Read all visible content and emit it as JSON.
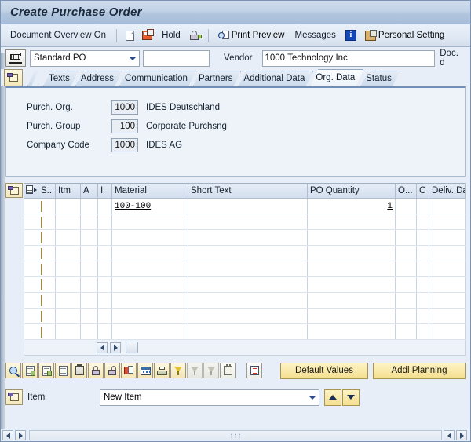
{
  "window": {
    "title": "Create Purchase Order"
  },
  "toolbar": {
    "document_overview": "Document Overview On",
    "hold": "Hold",
    "print_preview": "Print Preview",
    "messages": "Messages",
    "personal_setting": "Personal Setting",
    "icons": {
      "new_document": "new-document-icon",
      "copy": "copy-icon",
      "check_lock": "lock-icon",
      "print_preview": "print-preview-icon",
      "info": "info-icon",
      "personal_setting": "personal-setting-icon"
    }
  },
  "header": {
    "cart_icon": "shopping-cart-icon",
    "po_type": "Standard PO",
    "po_number": "",
    "vendor_label": "Vendor",
    "vendor_value": "1000 Technology Inc",
    "doc_date_label": "Doc. d"
  },
  "tabs": {
    "expand_icon": "header-detail-icon",
    "items": [
      {
        "label": "Texts",
        "active": false
      },
      {
        "label": "Address",
        "active": false
      },
      {
        "label": "Communication",
        "active": false
      },
      {
        "label": "Partners",
        "active": false
      },
      {
        "label": "Additional Data",
        "active": false
      },
      {
        "label": "Org. Data",
        "active": true
      },
      {
        "label": "Status",
        "active": false
      }
    ]
  },
  "org_data": {
    "fields": [
      {
        "label": "Purch. Org.",
        "value": "1000",
        "description": "IDES Deutschland"
      },
      {
        "label": "Purch. Group",
        "value": "100",
        "description": "Corporate Purchsng"
      },
      {
        "label": "Company Code",
        "value": "1000",
        "description": "IDES AG"
      }
    ]
  },
  "items_grid": {
    "left_icon": "item-detail-icon",
    "header_icon": "select-layout-icon",
    "columns": [
      {
        "key": "ctrl",
        "label": ""
      },
      {
        "key": "sel",
        "label": ""
      },
      {
        "key": "status",
        "label": "S.."
      },
      {
        "key": "itm",
        "label": "Itm"
      },
      {
        "key": "a",
        "label": "A"
      },
      {
        "key": "i",
        "label": "I"
      },
      {
        "key": "material",
        "label": "Material"
      },
      {
        "key": "short_text",
        "label": "Short Text"
      },
      {
        "key": "po_quantity",
        "label": "PO Quantity"
      },
      {
        "key": "o",
        "label": "O..."
      },
      {
        "key": "c",
        "label": "C"
      },
      {
        "key": "deliv_date",
        "label": "Deliv. Date"
      }
    ],
    "rows": [
      {
        "itm": "",
        "a": "",
        "i": "",
        "material": "100-100",
        "short_text": "",
        "po_quantity": "1",
        "o": "",
        "c": "",
        "deliv_date": ""
      },
      {
        "itm": "",
        "a": "",
        "i": "",
        "material": "",
        "short_text": "",
        "po_quantity": "",
        "o": "",
        "c": "",
        "deliv_date": ""
      },
      {
        "itm": "",
        "a": "",
        "i": "",
        "material": "",
        "short_text": "",
        "po_quantity": "",
        "o": "",
        "c": "",
        "deliv_date": ""
      },
      {
        "itm": "",
        "a": "",
        "i": "",
        "material": "",
        "short_text": "",
        "po_quantity": "",
        "o": "",
        "c": "",
        "deliv_date": ""
      },
      {
        "itm": "",
        "a": "",
        "i": "",
        "material": "",
        "short_text": "",
        "po_quantity": "",
        "o": "",
        "c": "",
        "deliv_date": ""
      },
      {
        "itm": "",
        "a": "",
        "i": "",
        "material": "",
        "short_text": "",
        "po_quantity": "",
        "o": "",
        "c": "",
        "deliv_date": ""
      },
      {
        "itm": "",
        "a": "",
        "i": "",
        "material": "",
        "short_text": "",
        "po_quantity": "",
        "o": "",
        "c": "",
        "deliv_date": ""
      },
      {
        "itm": "",
        "a": "",
        "i": "",
        "material": "",
        "short_text": "",
        "po_quantity": "",
        "o": "",
        "c": "",
        "deliv_date": ""
      },
      {
        "itm": "",
        "a": "",
        "i": "",
        "material": "",
        "short_text": "",
        "po_quantity": "",
        "o": "",
        "c": "",
        "deliv_date": ""
      }
    ]
  },
  "grid_toolbar": {
    "icons": [
      "search-icon",
      "insert-row-icon",
      "delete-row-icon",
      "copy-row-icon",
      "delete-icon",
      "lock-icon",
      "unlock-icon",
      "duplicate-icon",
      "table-settings-icon",
      "print-icon",
      "filter-icon",
      "filter-inactive-icon",
      "sort-inactive-icon",
      "plug-icon"
    ],
    "list_icon": "details-list-icon",
    "buttons": [
      {
        "label": "Default Values"
      },
      {
        "label": "Addl Planning"
      }
    ]
  },
  "item_footer": {
    "icon": "item-detail-icon",
    "label": "Item",
    "selected": "New Item",
    "prev_icon": "arrow-up-icon",
    "next_icon": "arrow-down-icon"
  },
  "colors": {
    "accent": "#f5e08f",
    "titlebar": "#b2c6de",
    "panel": "#eef3fa",
    "status_cell": "#f6dd7e"
  }
}
